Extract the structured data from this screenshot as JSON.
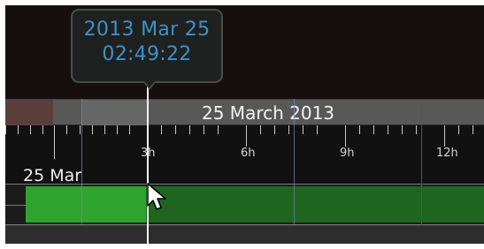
{
  "tooltip": {
    "date": "2013 Mar 25",
    "time": "02:49:22"
  },
  "timeline": {
    "date_band_label": "25 March 2013",
    "day_label": "25 Mar",
    "hour_labels": [
      "3h",
      "6h",
      "9h",
      "12h"
    ]
  },
  "icons": {
    "pointer": "mouse-pointer-icon"
  },
  "colors": {
    "tooltip_text": "#3c92c8",
    "played_track": "#2ea32e",
    "upcoming_track": "#1f641f"
  }
}
